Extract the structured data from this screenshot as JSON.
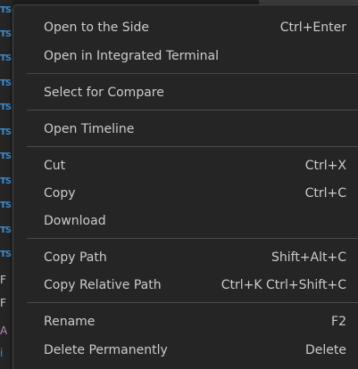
{
  "explorer": {
    "ts_badge": "TS",
    "misc_1": "F",
    "misc_2": "F",
    "misc_3": "A",
    "misc_4": "i"
  },
  "context_menu": {
    "groups": [
      [
        {
          "label": "Open to the Side",
          "shortcut": "Ctrl+Enter"
        },
        {
          "label": "Open in Integrated Terminal",
          "shortcut": ""
        }
      ],
      [
        {
          "label": "Select for Compare",
          "shortcut": ""
        }
      ],
      [
        {
          "label": "Open Timeline",
          "shortcut": ""
        }
      ],
      [
        {
          "label": "Cut",
          "shortcut": "Ctrl+X"
        },
        {
          "label": "Copy",
          "shortcut": "Ctrl+C"
        },
        {
          "label": "Download",
          "shortcut": ""
        }
      ],
      [
        {
          "label": "Copy Path",
          "shortcut": "Shift+Alt+C"
        },
        {
          "label": "Copy Relative Path",
          "shortcut": "Ctrl+K Ctrl+Shift+C"
        }
      ],
      [
        {
          "label": "Rename",
          "shortcut": "F2"
        },
        {
          "label": "Delete Permanently",
          "shortcut": "Delete"
        }
      ]
    ]
  }
}
